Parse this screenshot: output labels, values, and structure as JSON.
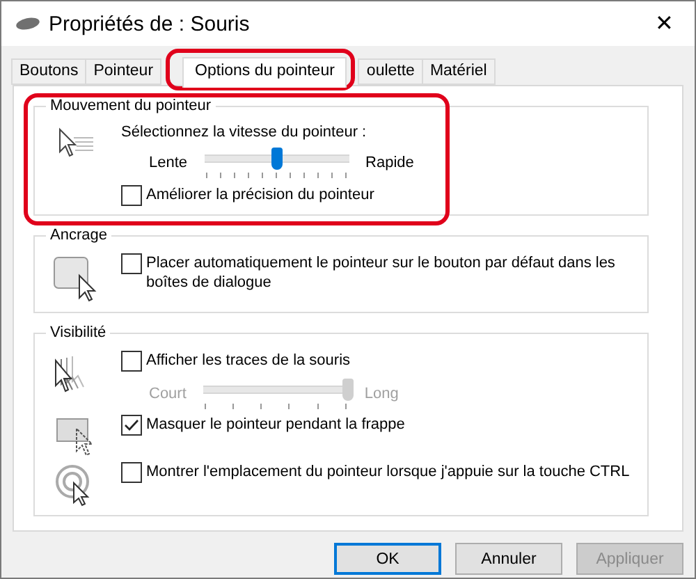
{
  "window": {
    "title": "Propriétés de : Souris",
    "close": "✕"
  },
  "tabs": [
    {
      "label": "Boutons",
      "selected": false,
      "highlighted": false
    },
    {
      "label": "Pointeur",
      "selected": false,
      "highlighted": false
    },
    {
      "label": "Options du pointeur",
      "selected": true,
      "highlighted": true
    },
    {
      "label": "oulette",
      "selected": false,
      "highlighted": false
    },
    {
      "label": "Matériel",
      "selected": false,
      "highlighted": false
    }
  ],
  "groups": [
    {
      "title": "Mouvement du pointeur",
      "highlighted": true,
      "rows": [
        {
          "items": [
            {
              "kind": "label",
              "text": "Sélectionnez la vitesse du pointeur :"
            },
            {
              "kind": "slider",
              "min_label": "Lente",
              "max_label": "Rapide",
              "level": 0.5,
              "disabled": false
            },
            {
              "kind": "checkbox",
              "label": "Améliorer la précision du pointeur",
              "checked": false
            }
          ]
        }
      ]
    },
    {
      "title": "Ancrage",
      "highlighted": false,
      "rows": [
        {
          "items": [
            {
              "kind": "checkbox",
              "label": "Placer automatiquement le pointeur sur le bouton par défaut dans les boîtes de dialogue",
              "checked": false
            }
          ]
        }
      ]
    },
    {
      "title": "Visibilité",
      "highlighted": false,
      "rows": [
        {
          "items": [
            {
              "kind": "checkbox",
              "label": "Afficher les traces de la souris",
              "checked": false
            },
            {
              "kind": "slider",
              "min_label": "Court",
              "max_label": "Long",
              "level": 1,
              "disabled": true
            }
          ]
        },
        {
          "items": [
            {
              "kind": "checkbox",
              "label": "Masquer le pointeur pendant la frappe",
              "checked": true
            }
          ]
        },
        {
          "items": [
            {
              "kind": "checkbox",
              "label": "Montrer l'emplacement du pointeur lorsque j'appuie sur la touche CTRL",
              "checked": false
            }
          ]
        }
      ]
    }
  ],
  "buttons": [
    {
      "label": "OK",
      "default": true,
      "disabled": false
    },
    {
      "label": "Annuler",
      "default": false,
      "disabled": false
    },
    {
      "label": "Appliquer",
      "default": false,
      "disabled": true
    }
  ]
}
